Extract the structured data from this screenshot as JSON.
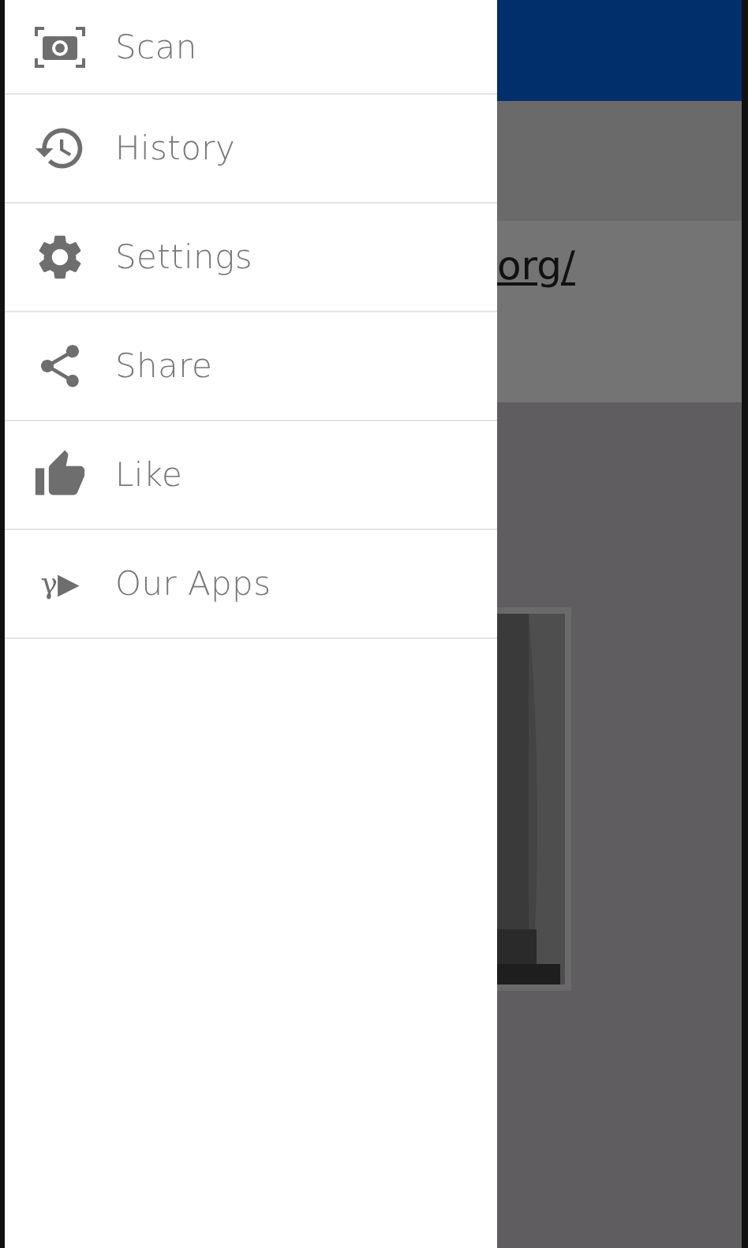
{
  "drawer": {
    "items": [
      {
        "label": "Scan"
      },
      {
        "label": "History"
      },
      {
        "label": "Settings"
      },
      {
        "label": "Share"
      },
      {
        "label": "Like"
      },
      {
        "label": "Our Apps",
        "glyph": "γ▶"
      }
    ]
  },
  "background": {
    "link": "org/",
    "kind": "picture"
  }
}
